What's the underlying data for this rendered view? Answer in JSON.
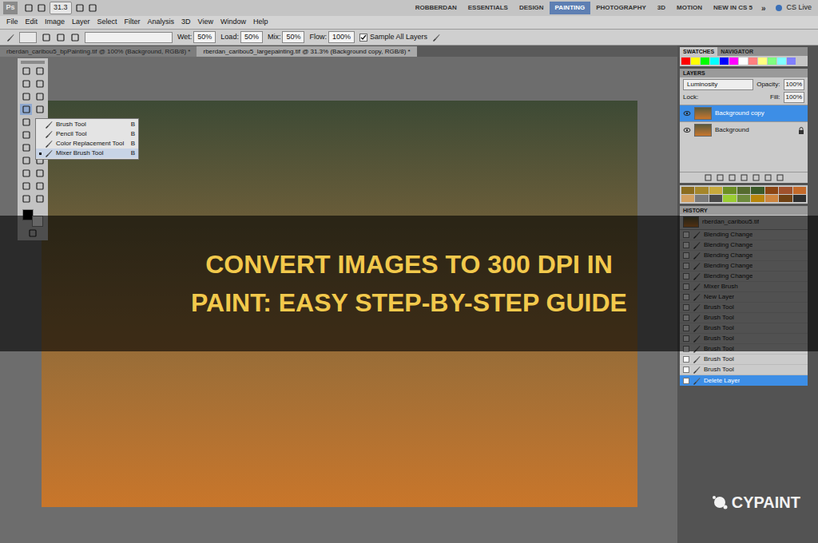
{
  "app_bar": {
    "logo": "Ps",
    "zoom": "31.3",
    "workspaces": [
      {
        "label": "ROBBERDAN",
        "selected": false
      },
      {
        "label": "ESSENTIALS",
        "selected": false
      },
      {
        "label": "DESIGN",
        "selected": false
      },
      {
        "label": "PAINTING",
        "selected": true
      },
      {
        "label": "PHOTOGRAPHY",
        "selected": false
      },
      {
        "label": "3D",
        "selected": false
      },
      {
        "label": "MOTION",
        "selected": false
      },
      {
        "label": "NEW IN CS 5",
        "selected": false
      }
    ],
    "more": "»",
    "cs_live": "CS Live"
  },
  "menu": [
    "File",
    "Edit",
    "Image",
    "Layer",
    "Select",
    "Filter",
    "Analysis",
    "3D",
    "View",
    "Window",
    "Help"
  ],
  "options_bar": {
    "fields": [
      {
        "label": "Wet:",
        "value": "50%"
      },
      {
        "label": "Load:",
        "value": "50%"
      },
      {
        "label": "Mix:",
        "value": "50%"
      },
      {
        "label": "Flow:",
        "value": "100%"
      }
    ],
    "sample_all_layers": {
      "label": "Sample All Layers",
      "checked": true
    }
  },
  "documents": [
    {
      "title": "rberdan_caribou5_bpPainting.tif @ 100% (Background, RGB/8) *",
      "selected": false
    },
    {
      "title": "rberdan_caribou5_largepainting.tif @ 31.3% (Background copy, RGB/8) *",
      "selected": true
    }
  ],
  "tool_flyout": [
    {
      "label": "Brush Tool",
      "shortcut": "B",
      "selected": false
    },
    {
      "label": "Pencil Tool",
      "shortcut": "B",
      "selected": false
    },
    {
      "label": "Color Replacement Tool",
      "shortcut": "B",
      "selected": false
    },
    {
      "label": "Mixer Brush Tool",
      "shortcut": "B",
      "selected": true
    }
  ],
  "swatches": {
    "tabs": [
      {
        "label": "SWATCHES",
        "selected": true
      },
      {
        "label": "NAVIGATOR",
        "selected": false
      }
    ],
    "colors": [
      {
        "color": "#ff0000"
      },
      {
        "color": "#ffff00"
      },
      {
        "color": "#00ff00"
      },
      {
        "color": "#00ffff"
      },
      {
        "color": "#0000ff"
      },
      {
        "color": "#ff00ff"
      },
      {
        "color": "#ffffff"
      },
      {
        "color": "#ff8080"
      },
      {
        "color": "#ffff80"
      },
      {
        "color": "#80ff80"
      },
      {
        "color": "#80ffff"
      },
      {
        "color": "#8080ff"
      }
    ],
    "grid": [
      {
        "color": "#8c6d1f"
      },
      {
        "color": "#a5862a"
      },
      {
        "color": "#c7a93c"
      },
      {
        "color": "#6b8e23"
      },
      {
        "color": "#556b2f"
      },
      {
        "color": "#3c5a28"
      },
      {
        "color": "#8b4513"
      },
      {
        "color": "#a0522d"
      },
      {
        "color": "#c46a2a"
      },
      {
        "color": "#d2a060"
      },
      {
        "color": "#7a7a7a"
      },
      {
        "color": "#4a4a4a"
      },
      {
        "color": "#9acd32"
      },
      {
        "color": "#6e8b3d"
      },
      {
        "color": "#b8860b"
      },
      {
        "color": "#cd853f"
      },
      {
        "color": "#704214"
      },
      {
        "color": "#2f2f2f"
      }
    ]
  },
  "layers": {
    "title": "LAYERS",
    "blend_mode": "Luminosity",
    "opacity_label": "Opacity:",
    "opacity": "100%",
    "lock_label": "Lock:",
    "fill_label": "Fill:",
    "fill": "100%",
    "items": [
      {
        "name": "Background copy",
        "selected": true,
        "locked": false
      },
      {
        "name": "Background",
        "selected": false,
        "locked": true
      }
    ]
  },
  "history": {
    "title": "HISTORY",
    "snapshot": "rberdan_caribou5.tif",
    "items": [
      {
        "label": "Blending Change",
        "selected": false
      },
      {
        "label": "Blending Change",
        "selected": false
      },
      {
        "label": "Blending Change",
        "selected": false
      },
      {
        "label": "Blending Change",
        "selected": false
      },
      {
        "label": "Blending Change",
        "selected": false
      },
      {
        "label": "Mixer Brush",
        "selected": false
      },
      {
        "label": "New Layer",
        "selected": false
      },
      {
        "label": "Brush Tool",
        "selected": false
      },
      {
        "label": "Brush Tool",
        "selected": false
      },
      {
        "label": "Brush Tool",
        "selected": false
      },
      {
        "label": "Brush Tool",
        "selected": false
      },
      {
        "label": "Brush Tool",
        "selected": false
      },
      {
        "label": "Brush Tool",
        "selected": false
      },
      {
        "label": "Brush Tool",
        "selected": false
      },
      {
        "label": "Delete Layer",
        "selected": true
      }
    ]
  },
  "banner": {
    "lines": [
      "CONVERT IMAGES TO 300 DPI IN",
      "PAINT: EASY STEP-BY-STEP GUIDE"
    ]
  },
  "watermark": {
    "brand": "CYPAINT"
  }
}
